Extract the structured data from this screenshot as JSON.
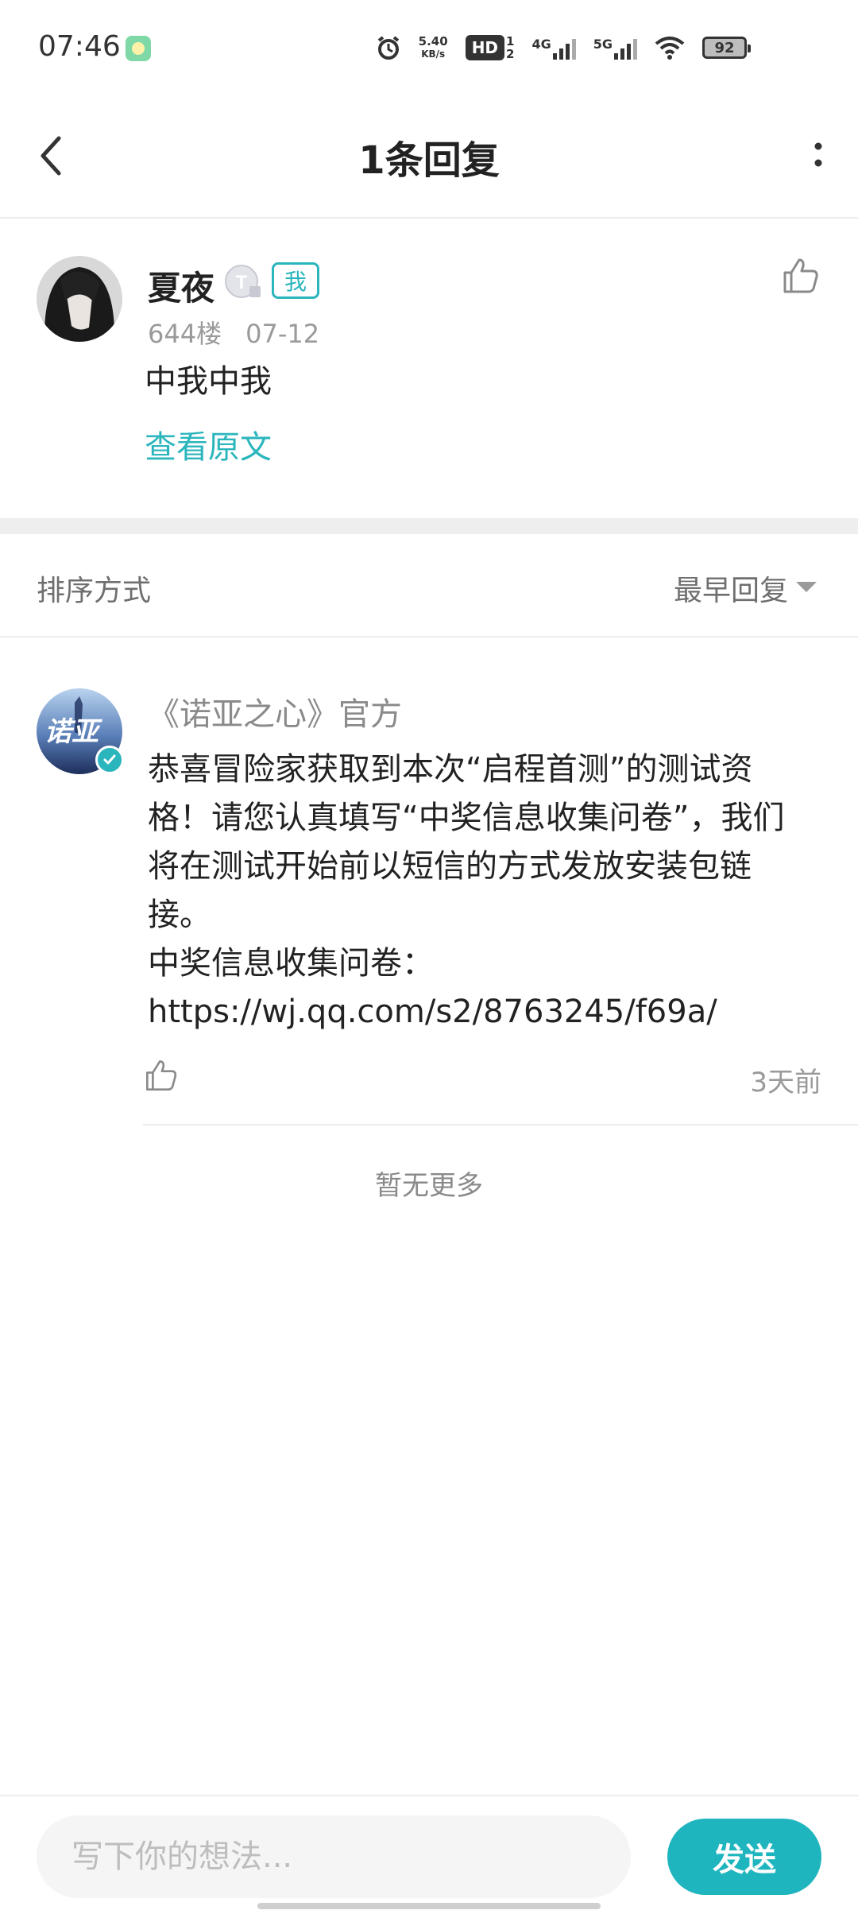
{
  "status_bar": {
    "time": "07:46",
    "net_speed_value": "5.40",
    "net_speed_unit": "KB/s",
    "hd_label": "HD",
    "sim_1": "1",
    "sim_2": "2",
    "net_4g": "4G",
    "net_5g": "5G",
    "battery": "92"
  },
  "nav": {
    "title": "1条回复"
  },
  "post": {
    "author": "夏夜",
    "me_tag": "我",
    "floor": "644楼",
    "date": "07-12",
    "content": "中我中我",
    "view_original": "查看原文"
  },
  "sort": {
    "label": "排序方式",
    "value": "最早回复"
  },
  "reply": {
    "author": "《诺亚之心》官方",
    "avatar_text": "诺亚",
    "content": "恭喜冒险家获取到本次“启程首测”的测试资\n格！请您认真填写“中奖信息收集问卷”，我们\n将在测试开始前以短信的方式发放安装包链\n接。\n中奖信息收集问卷：\nhttps://wj.qq.com/s2/8763245/f69a/",
    "time": "3天前"
  },
  "footer": {
    "no_more": "暂无更多"
  },
  "composer": {
    "placeholder": "写下你的想法...",
    "send_label": "发送"
  },
  "colors": {
    "accent": "#2bb5bd",
    "send_button": "#1fb5bf",
    "muted_text": "#9a9a9a"
  }
}
